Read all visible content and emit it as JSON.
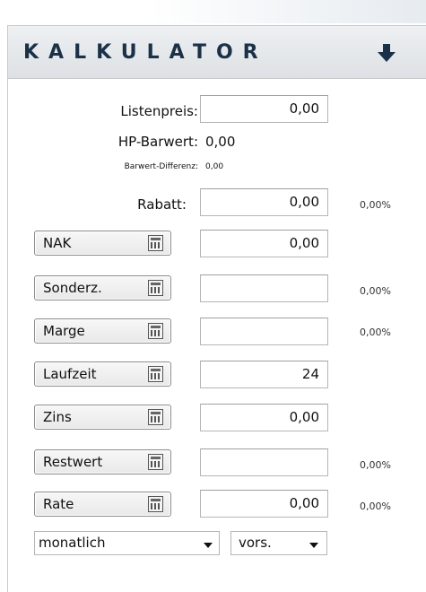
{
  "panel": {
    "title": "KALKULATOR"
  },
  "fields": {
    "listenpreis": {
      "label": "Listenpreis:",
      "value": "0,00"
    },
    "hp_barwert": {
      "label": "HP-Barwert:",
      "value": "0,00"
    },
    "barwert_differenz": {
      "label": "Barwert-Differenz:",
      "value": "0,00"
    },
    "rabatt": {
      "label": "Rabatt:",
      "value": "0,00",
      "percent": "0,00%"
    },
    "nak": {
      "label": "NAK",
      "value": "0,00"
    },
    "sonderz": {
      "label": "Sonderz.",
      "value": "",
      "percent": "0,00%"
    },
    "marge": {
      "label": "Marge",
      "value": "",
      "percent": "0,00%"
    },
    "laufzeit": {
      "label": "Laufzeit",
      "value": "24"
    },
    "zins": {
      "label": "Zins",
      "value": "0,00"
    },
    "restwert": {
      "label": "Restwert",
      "value": "",
      "percent": "0,00%"
    },
    "rate": {
      "label": "Rate",
      "value": "0,00",
      "percent": "0,00%"
    }
  },
  "selects": {
    "interval": {
      "selected": "monatlich"
    },
    "timing": {
      "selected": "vors."
    }
  },
  "colors": {
    "title": "#1b3147",
    "header_bg": "#dde1e5",
    "border": "#b5b5b5"
  },
  "icons": {
    "header": "arrow-down-icon",
    "buttons": "calculator-icon"
  }
}
